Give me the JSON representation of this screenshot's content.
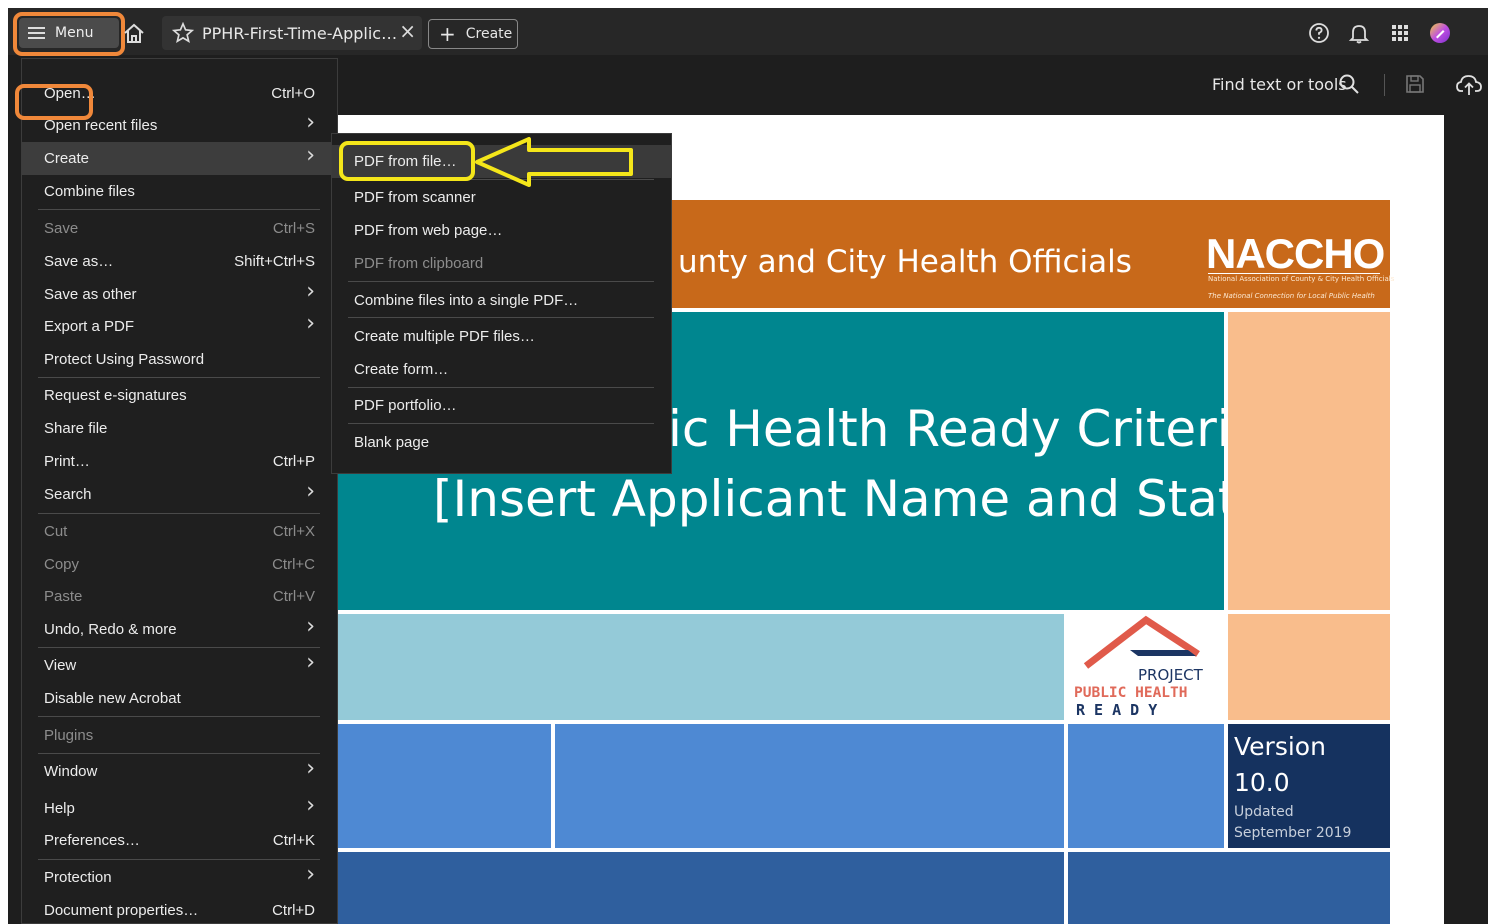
{
  "tabbar": {
    "menu_label": "Menu",
    "tab_title": "PPHR-First-Time-Applic…",
    "tab_close": "×",
    "create_label": "Create"
  },
  "toolbar": {
    "find_label": "Find text or tools"
  },
  "main_menu": [
    {
      "label": "Open…",
      "shortcut": "Ctrl+O",
      "submenu": false,
      "disabled": false
    },
    {
      "label": "Open recent files",
      "shortcut": "",
      "submenu": true,
      "disabled": false
    },
    {
      "label": "Create",
      "shortcut": "",
      "submenu": true,
      "disabled": false,
      "active": true
    },
    {
      "label": "Combine files",
      "shortcut": "",
      "submenu": false,
      "disabled": false
    },
    {
      "label": "Save",
      "shortcut": "Ctrl+S",
      "submenu": false,
      "disabled": true
    },
    {
      "label": "Save as…",
      "shortcut": "Shift+Ctrl+S",
      "submenu": false,
      "disabled": false
    },
    {
      "label": "Save as other",
      "shortcut": "",
      "submenu": true,
      "disabled": false
    },
    {
      "label": "Export a PDF",
      "shortcut": "",
      "submenu": true,
      "disabled": false
    },
    {
      "label": "Protect Using Password",
      "shortcut": "",
      "submenu": false,
      "disabled": false
    },
    {
      "label": "Request e-signatures",
      "shortcut": "",
      "submenu": false,
      "disabled": false
    },
    {
      "label": "Share file",
      "shortcut": "",
      "submenu": false,
      "disabled": false
    },
    {
      "label": "Print…",
      "shortcut": "Ctrl+P",
      "submenu": false,
      "disabled": false
    },
    {
      "label": "Search",
      "shortcut": "",
      "submenu": true,
      "disabled": false
    },
    {
      "label": "Cut",
      "shortcut": "Ctrl+X",
      "submenu": false,
      "disabled": true
    },
    {
      "label": "Copy",
      "shortcut": "Ctrl+C",
      "submenu": false,
      "disabled": true
    },
    {
      "label": "Paste",
      "shortcut": "Ctrl+V",
      "submenu": false,
      "disabled": true
    },
    {
      "label": "Undo, Redo & more",
      "shortcut": "",
      "submenu": true,
      "disabled": false
    },
    {
      "label": "View",
      "shortcut": "",
      "submenu": true,
      "disabled": false
    },
    {
      "label": "Disable new Acrobat",
      "shortcut": "",
      "submenu": false,
      "disabled": false
    },
    {
      "label": "Plugins",
      "shortcut": "",
      "submenu": false,
      "disabled": true
    },
    {
      "label": "Window",
      "shortcut": "",
      "submenu": true,
      "disabled": false
    },
    {
      "label": "Help",
      "shortcut": "",
      "submenu": true,
      "disabled": false
    },
    {
      "label": "Preferences…",
      "shortcut": "Ctrl+K",
      "submenu": false,
      "disabled": false
    },
    {
      "label": "Protection",
      "shortcut": "",
      "submenu": true,
      "disabled": false
    },
    {
      "label": "Document properties…",
      "shortcut": "Ctrl+D",
      "submenu": false,
      "disabled": false
    }
  ],
  "create_submenu": [
    {
      "label": "PDF from file…",
      "disabled": false,
      "active": true
    },
    {
      "label": "PDF from scanner",
      "disabled": false
    },
    {
      "label": "PDF from web page…",
      "disabled": false
    },
    {
      "label": "PDF from clipboard",
      "disabled": true
    },
    {
      "label": "Combine files into a single PDF…",
      "disabled": false
    },
    {
      "label": "Create multiple PDF files…",
      "disabled": false
    },
    {
      "label": "Create form…",
      "disabled": false
    },
    {
      "label": "PDF portfolio…",
      "disabled": false
    },
    {
      "label": "Blank page",
      "disabled": false
    }
  ],
  "document": {
    "band_text": "unty and City Health Officials",
    "logo_text": "NACCHO",
    "logo_sub1": "National Association of County & City Health Officials",
    "logo_sub2": "The National Connection for Local Public Health",
    "title_line1": "ic Health Ready Criteria",
    "title_line2": "[Insert Applicant Name and State]",
    "pphr_project": "PROJECT",
    "pphr_public_health": "PUBLIC HEALTH",
    "pphr_ready": "R E A D Y",
    "version_label": "Version",
    "version_number": "10.0",
    "updated_label": "Updated",
    "updated_date": "September 2019"
  },
  "colors": {
    "highlight_orange": "#f0883a",
    "highlight_yellow": "#f4e61a",
    "naccho_orange": "#c8691a",
    "teal": "#00868f"
  }
}
